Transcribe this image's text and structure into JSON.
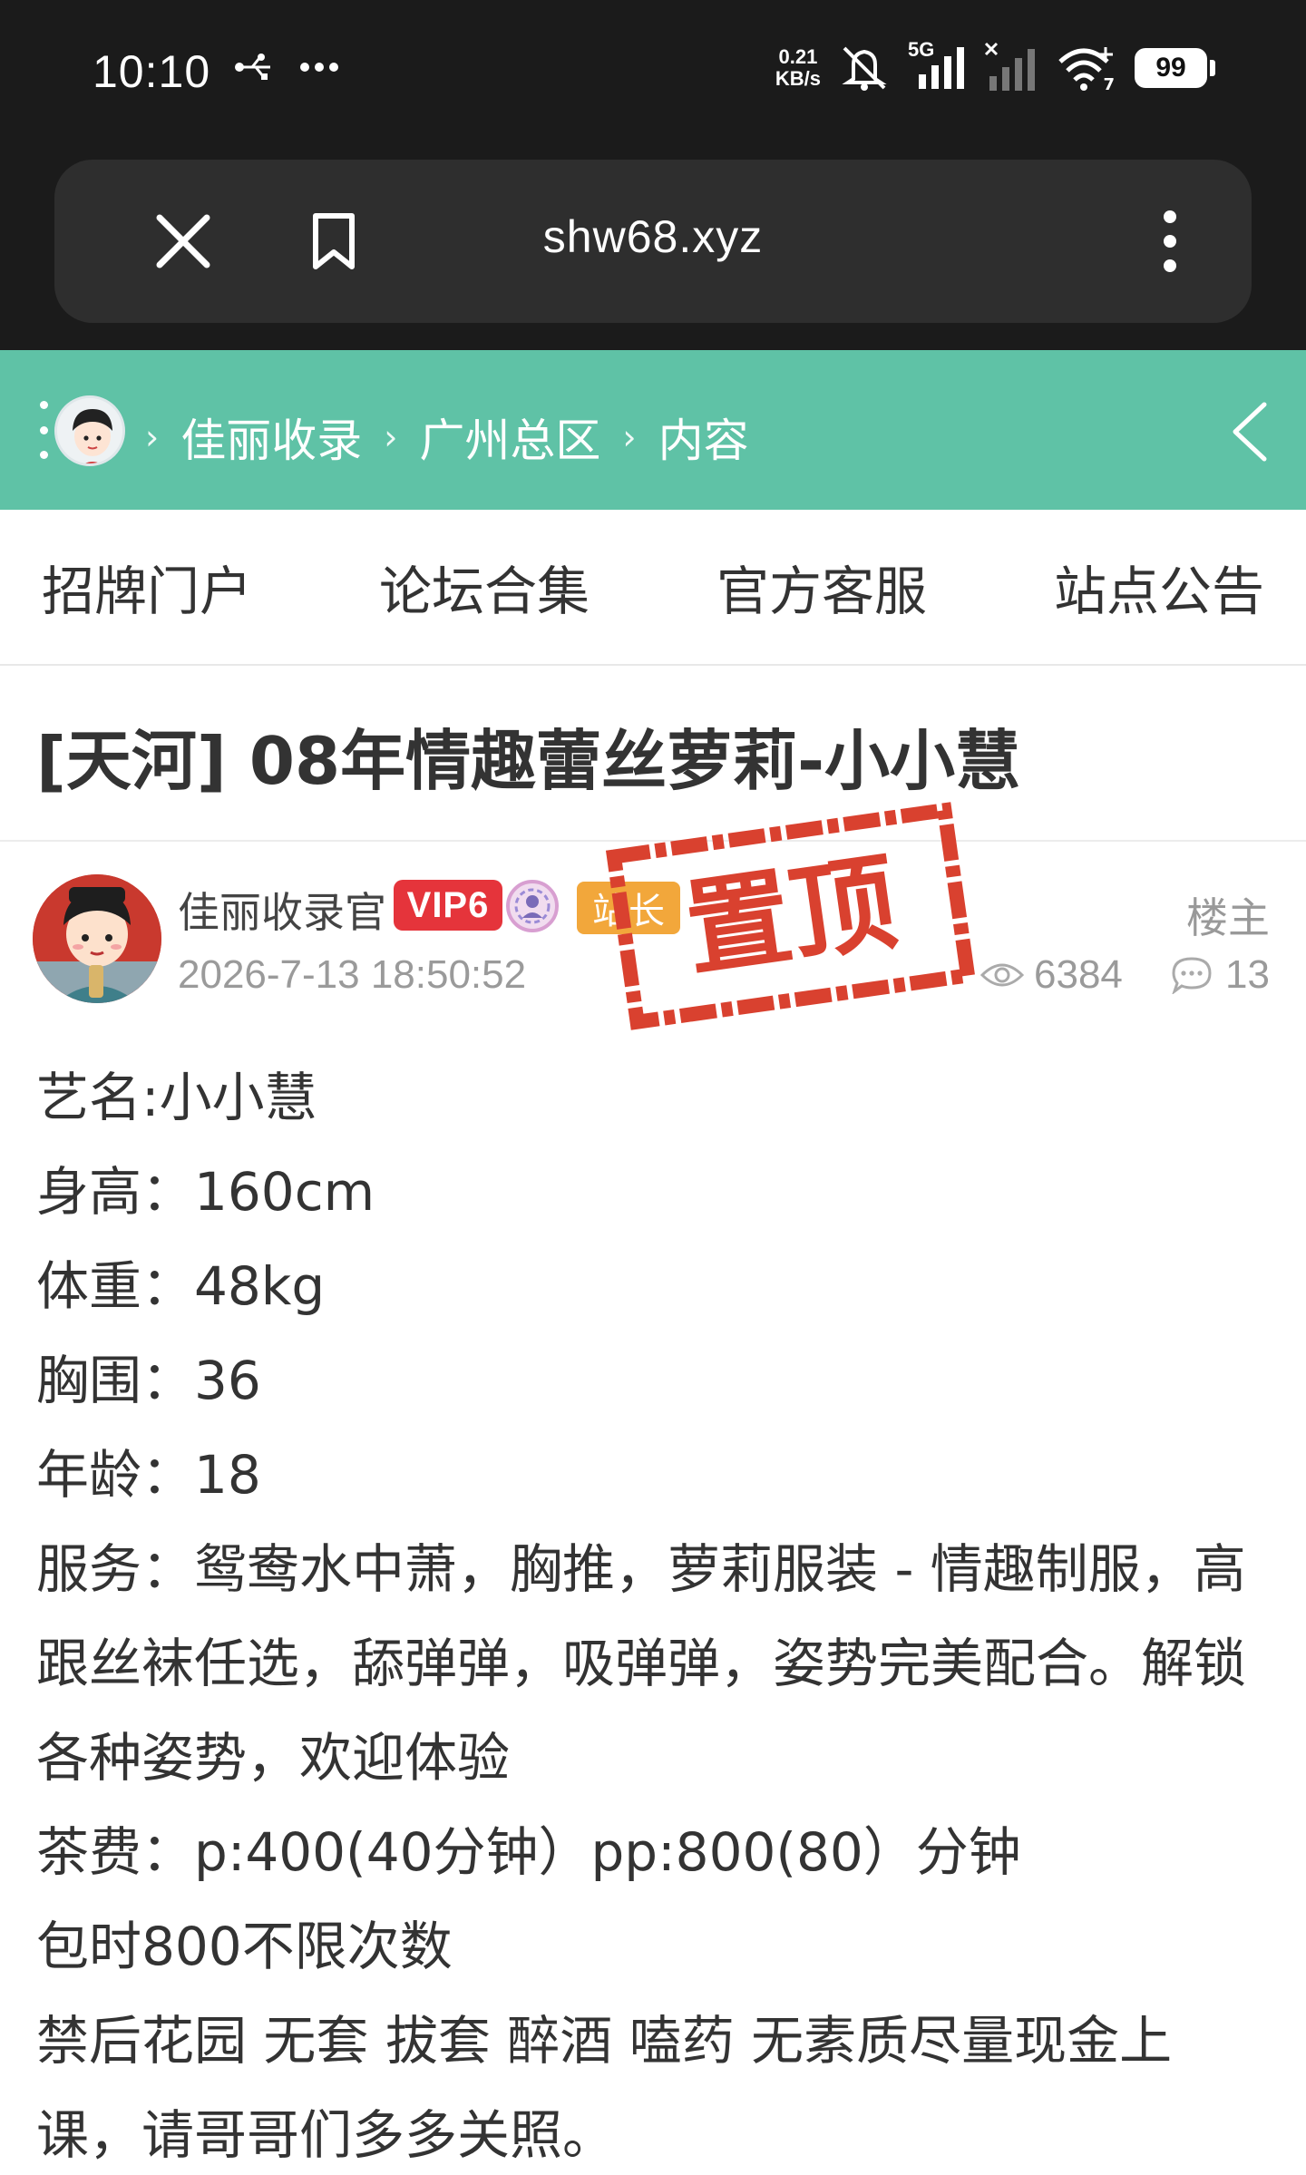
{
  "status_bar": {
    "time": "10:10",
    "net_speed_value": "0.21",
    "net_speed_unit": "KB/s",
    "network_label": "5G",
    "wifi_label": "7",
    "battery": "99"
  },
  "browser": {
    "url": "shw68.xyz"
  },
  "breadcrumb": {
    "items": [
      "佳丽收录",
      "广州总区",
      "内容"
    ],
    "separator": "›"
  },
  "nav": {
    "tabs": [
      "招牌门户",
      "论坛合集",
      "官方客服",
      "站点公告"
    ]
  },
  "post": {
    "title": "[天河] 08年情趣蕾丝萝莉-小小慧",
    "author": "佳丽收录官",
    "vip_badge": "VIP6",
    "admin_badge": "站长",
    "floor_label": "楼主",
    "date": "2026-7-13 18:50:52",
    "views": "6384",
    "replies": "13",
    "pinned_stamp": "置顶",
    "body": [
      "艺名:小小慧",
      "身高：160cm",
      "体重：48kg",
      "胸围：36",
      "年龄：18",
      "服务：鸳鸯水中萧，胸推，萝莉服装 - 情趣制服，高跟丝袜任选，舔弹弹，吸弹弹，姿势完美配合。解锁各种姿势，欢迎体验",
      "茶费：p:400(40分钟）pp:800(80）分钟",
      "包时800不限次数",
      "禁后花园 无套 拔套 醉酒 嗑药 无素质尽量现金上课，请哥哥们多多关照。"
    ]
  },
  "colors": {
    "header_teal": "#5fc2a6",
    "vip_red": "#e5343b",
    "admin_orange": "#f2a73b",
    "stamp_red": "#d9412f"
  }
}
